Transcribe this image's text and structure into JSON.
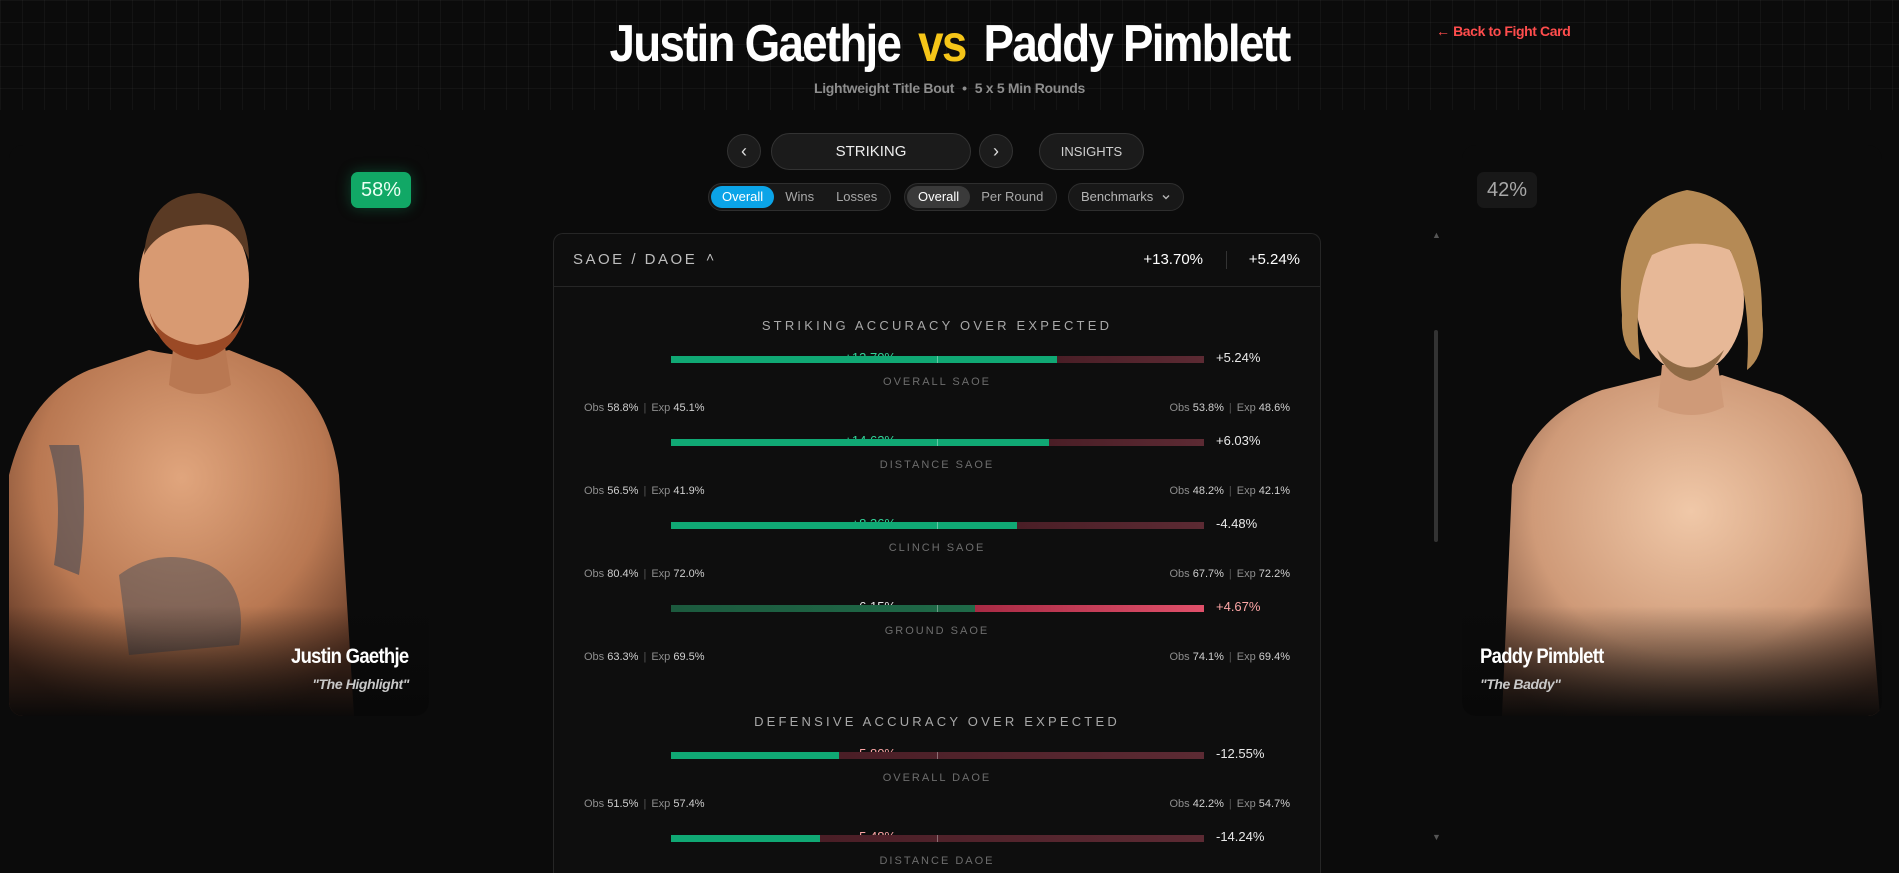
{
  "header": {
    "fighter_left": "Justin Gaethje",
    "vs": "vs",
    "fighter_right": "Paddy Pimblett",
    "bout_type": "Lightweight Title Bout",
    "rounds": "5 x 5 Min Rounds",
    "back_link": "← Back to Fight Card"
  },
  "fighters": {
    "left": {
      "name": "Justin Gaethje",
      "nickname": "\"The Highlight\"",
      "win_probability": "58%"
    },
    "right": {
      "name": "Paddy Pimblett",
      "nickname": "\"The Baddy\"",
      "win_probability": "42%"
    }
  },
  "controls": {
    "prev_icon": "‹",
    "category": "STRIKING",
    "next_icon": "›",
    "insights": "INSIGHTS",
    "filters": [
      "Overall",
      "Wins",
      "Losses"
    ],
    "filter_active": "Overall",
    "views": [
      "Overall",
      "Per Round"
    ],
    "view_active": "Overall",
    "benchmarks": "Benchmarks",
    "benchmarks_icon": "chevron-down-icon"
  },
  "panel": {
    "title": "SAOE / DAOE",
    "caret": "˄",
    "summary_left": "+13.70%",
    "summary_right": "+5.24%",
    "obs_label": "Obs",
    "exp_label": "Exp",
    "sections": [
      {
        "title": "STRIKING ACCURACY OVER EXPECTED",
        "metrics": [
          {
            "label": "OVERALL SAOE",
            "left": "+13.70%",
            "right": "+5.24%",
            "left_share": 0.725,
            "left_obs": "58.8%",
            "left_exp": "45.1%",
            "right_obs": "53.8%",
            "right_exp": "48.6%"
          },
          {
            "label": "DISTANCE SAOE",
            "left": "+14.62%",
            "right": "+6.03%",
            "left_share": 0.71,
            "left_obs": "56.5%",
            "left_exp": "41.9%",
            "right_obs": "48.2%",
            "right_exp": "42.1%"
          },
          {
            "label": "CLINCH SAOE",
            "left": "+8.36%",
            "right": "-4.48%",
            "left_share": 0.65,
            "left_obs": "80.4%",
            "left_exp": "72.0%",
            "right_obs": "67.7%",
            "right_exp": "72.2%"
          },
          {
            "label": "GROUND SAOE",
            "left": "-6.15%",
            "right": "+4.67%",
            "left_share": 0.57,
            "left_obs": "63.3%",
            "left_exp": "69.5%",
            "right_obs": "74.1%",
            "right_exp": "69.4%"
          }
        ]
      },
      {
        "title": "DEFENSIVE ACCURACY OVER EXPECTED",
        "metrics": [
          {
            "label": "OVERALL DAOE",
            "left": "-5.80%",
            "right": "-12.55%",
            "left_share": 0.315,
            "left_obs": "51.5%",
            "left_exp": "57.4%",
            "right_obs": "42.2%",
            "right_exp": "54.7%"
          },
          {
            "label": "DISTANCE DAOE",
            "left": "-5.48%",
            "right": "-14.24%",
            "left_share": 0.28
          }
        ]
      }
    ]
  },
  "colors": {
    "accent_green": "#34d399",
    "accent_red": "#fca5a5",
    "bar_green": "#10a874",
    "bar_red": "#d03a55",
    "vs_yellow": "#f5c518",
    "filter_blue": "#0ba4e8",
    "back_link": "#ff4d4d"
  }
}
